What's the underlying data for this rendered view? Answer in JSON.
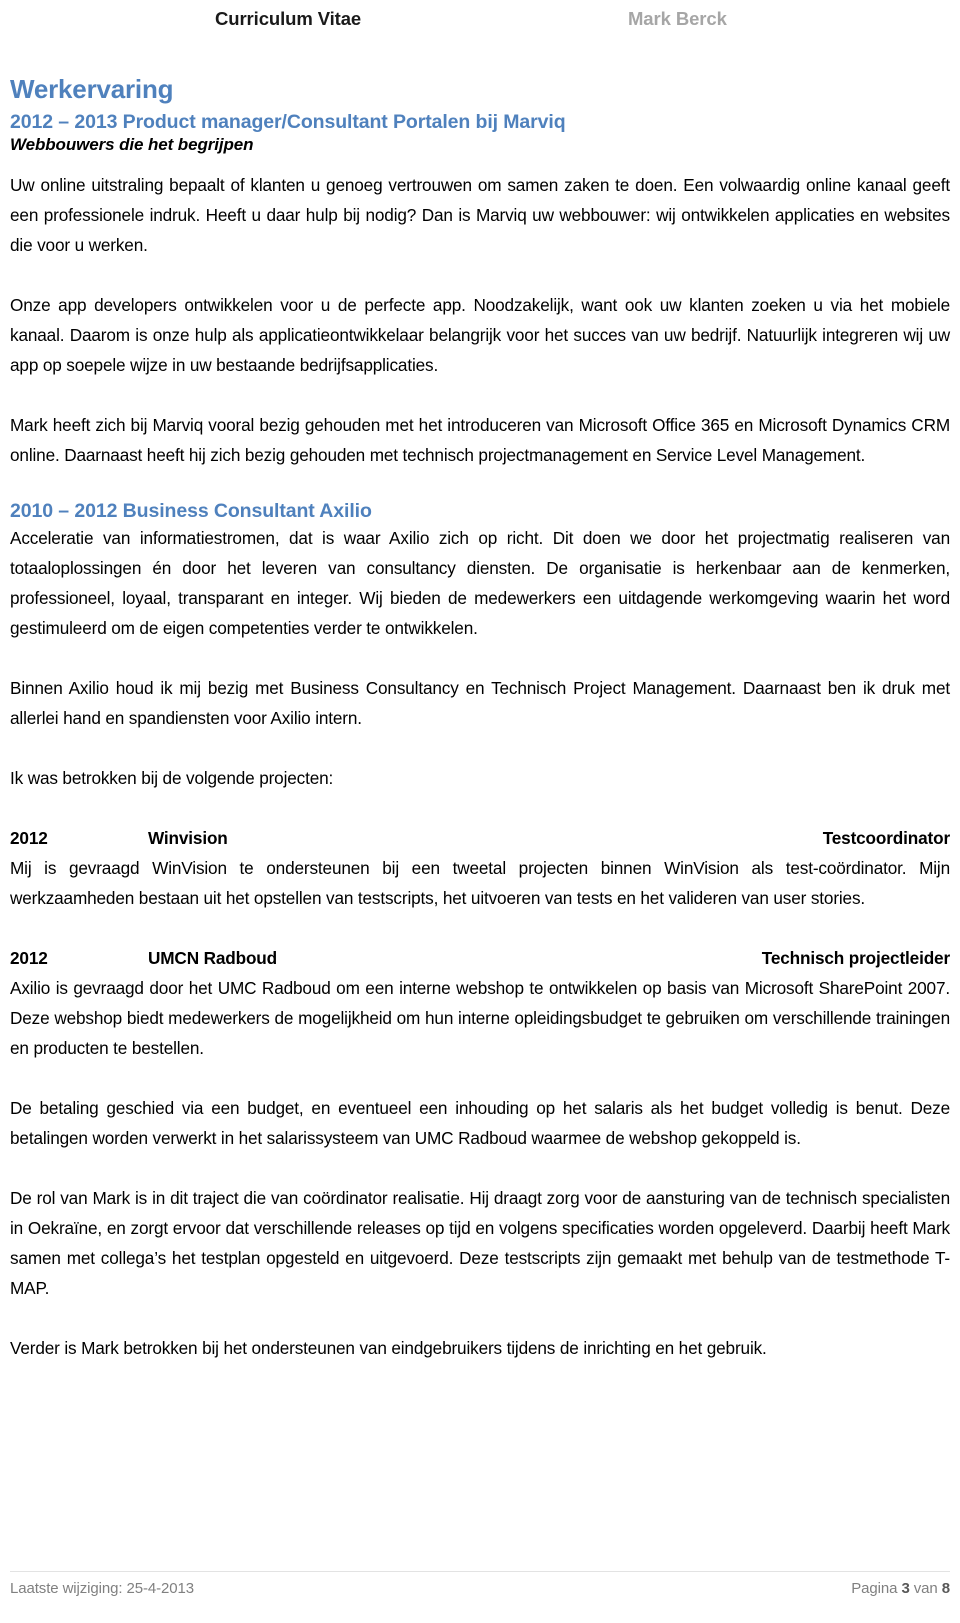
{
  "header": {
    "title": "Curriculum Vitae",
    "name": "Mark Berck"
  },
  "section": {
    "heading": "Werkervaring"
  },
  "jobs": [
    {
      "period_title": "2012 – 2013 Product manager/Consultant Portalen bij Marviq",
      "subtitle": "Webbouwers die het begrijpen",
      "paragraphs": [
        "Uw online uitstraling bepaalt of klanten u genoeg vertrouwen om samen zaken te doen. Een volwaardig online kanaal geeft een professionele indruk. Heeft u daar hulp bij nodig? Dan is Marviq uw webbouwer: wij ontwikkelen applicaties en websites die voor u werken.",
        "Onze app developers ontwikkelen voor u de perfecte app. Noodzakelijk, want ook uw klanten zoeken u via het mobiele kanaal. Daarom is onze hulp als applicatieontwikkelaar belangrijk voor het succes van uw bedrijf. Natuurlijk integreren wij uw app op soepele wijze in uw bestaande bedrijfsapplicaties.",
        "Mark heeft zich bij Marviq vooral bezig gehouden met het introduceren van Microsoft Office 365 en Microsoft Dynamics CRM online. Daarnaast heeft hij zich bezig gehouden met technisch projectmanagement en Service Level Management."
      ]
    },
    {
      "period_title": "2010 – 2012    Business Consultant  Axilio",
      "paragraphs": [
        "Acceleratie van informatiestromen, dat is waar Axilio zich op richt. Dit doen we door het projectmatig realiseren van totaaloplossingen én door het leveren van consultancy diensten. De organisatie is herkenbaar aan de kenmerken, professioneel, loyaal, transparant en integer. Wij bieden de medewerkers een uitdagende werkomgeving waarin het word gestimuleerd om de eigen competenties verder te ontwikkelen.",
        "Binnen Axilio houd ik mij bezig met Business Consultancy en Technisch Project Management. Daarnaast ben ik druk met allerlei hand en spandiensten voor Axilio intern.",
        "Ik was betrokken bij de volgende projecten:"
      ]
    }
  ],
  "projects": [
    {
      "year": "2012",
      "client": "Winvision",
      "role": "Testcoordinator",
      "paragraphs": [
        "Mij is gevraagd WinVision te ondersteunen bij een tweetal projecten binnen WinVision als test-coördinator. Mijn werkzaamheden bestaan uit het opstellen van testscripts, het uitvoeren van tests en het valideren van user stories."
      ]
    },
    {
      "year": "2012",
      "client": "UMCN Radboud",
      "role": "Technisch projectleider",
      "paragraphs": [
        "Axilio is gevraagd door het UMC Radboud om een interne webshop te ontwikkelen op basis van Microsoft SharePoint 2007. Deze webshop biedt medewerkers de mogelijkheid om hun interne opleidingsbudget te gebruiken om verschillende trainingen en producten te bestellen.",
        "De betaling geschied via een budget, en eventueel een inhouding op het salaris als het budget volledig is benut. Deze betalingen worden verwerkt in het salarissysteem van UMC Radboud waarmee de webshop gekoppeld is.",
        "De rol van Mark is in dit traject die van coördinator realisatie. Hij draagt zorg voor de aansturing van de technisch specialisten in Oekraïne, en zorgt ervoor dat verschillende releases op tijd en volgens specificaties worden opgeleverd. Daarbij heeft Mark samen met collega’s het testplan opgesteld en uitgevoerd. Deze testscripts zijn gemaakt met behulp van de testmethode T-MAP.",
        "Verder is Mark betrokken bij het ondersteunen van eindgebruikers tijdens de inrichting en het gebruik."
      ]
    }
  ],
  "footer": {
    "modified_label": "Laatste wijziging: 25-4-2013",
    "page_prefix": "Pagina ",
    "page_current": "3",
    "page_middle": " van ",
    "page_total": "8"
  },
  "colors": {
    "accent_blue": "#4f81bd",
    "header_name_gray": "#a6a6a6",
    "footer_gray": "#808080"
  }
}
